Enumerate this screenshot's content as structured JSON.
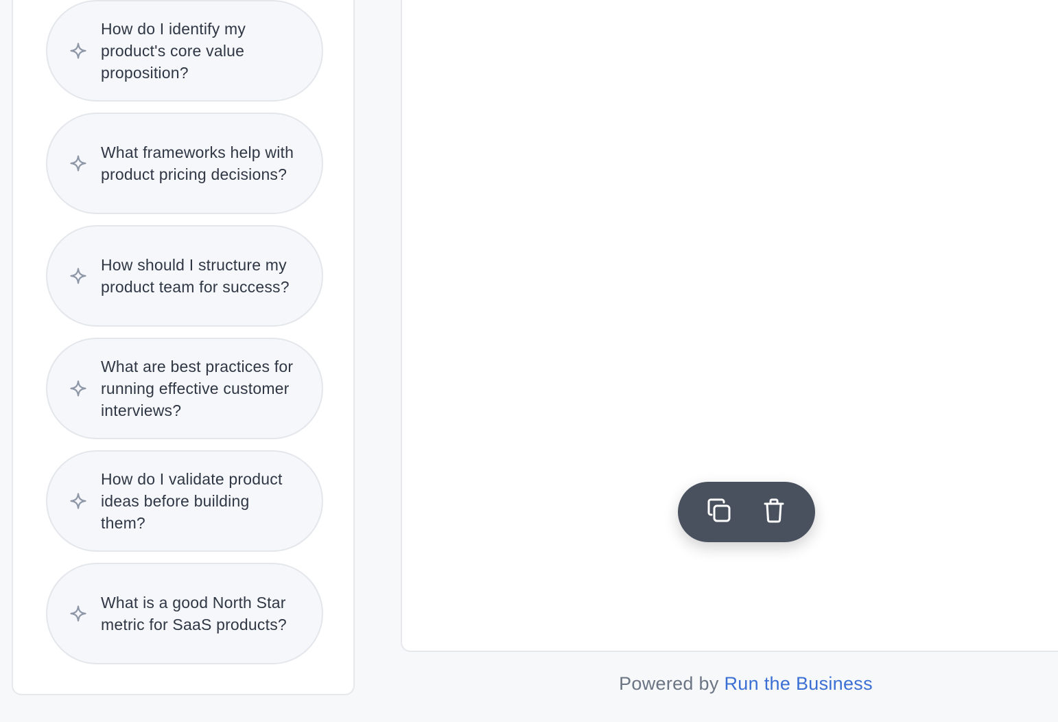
{
  "suggestions": [
    {
      "label": "How do I identify my product's core value proposition?",
      "icon": "sparkle-icon"
    },
    {
      "label": "What frameworks help with product pricing decisions?",
      "icon": "sparkle-icon"
    },
    {
      "label": "How should I structure my product team for success?",
      "icon": "sparkle-icon"
    },
    {
      "label": "What are best practices for running effective customer interviews?",
      "icon": "sparkle-icon"
    },
    {
      "label": "How do I validate product ideas before building them?",
      "icon": "sparkle-icon"
    },
    {
      "label": "What is a good North Star metric for SaaS products?",
      "icon": "sparkle-icon"
    }
  ],
  "toolbar": {
    "copy_icon": "copy-icon",
    "delete_icon": "trash-icon"
  },
  "footer": {
    "prefix": "Powered by",
    "link_text": "Run the Business"
  },
  "colors": {
    "accent": "#3b6fd4",
    "toolbar_bg": "#4a515e",
    "text": "#2f3744",
    "muted": "#6b7483"
  }
}
